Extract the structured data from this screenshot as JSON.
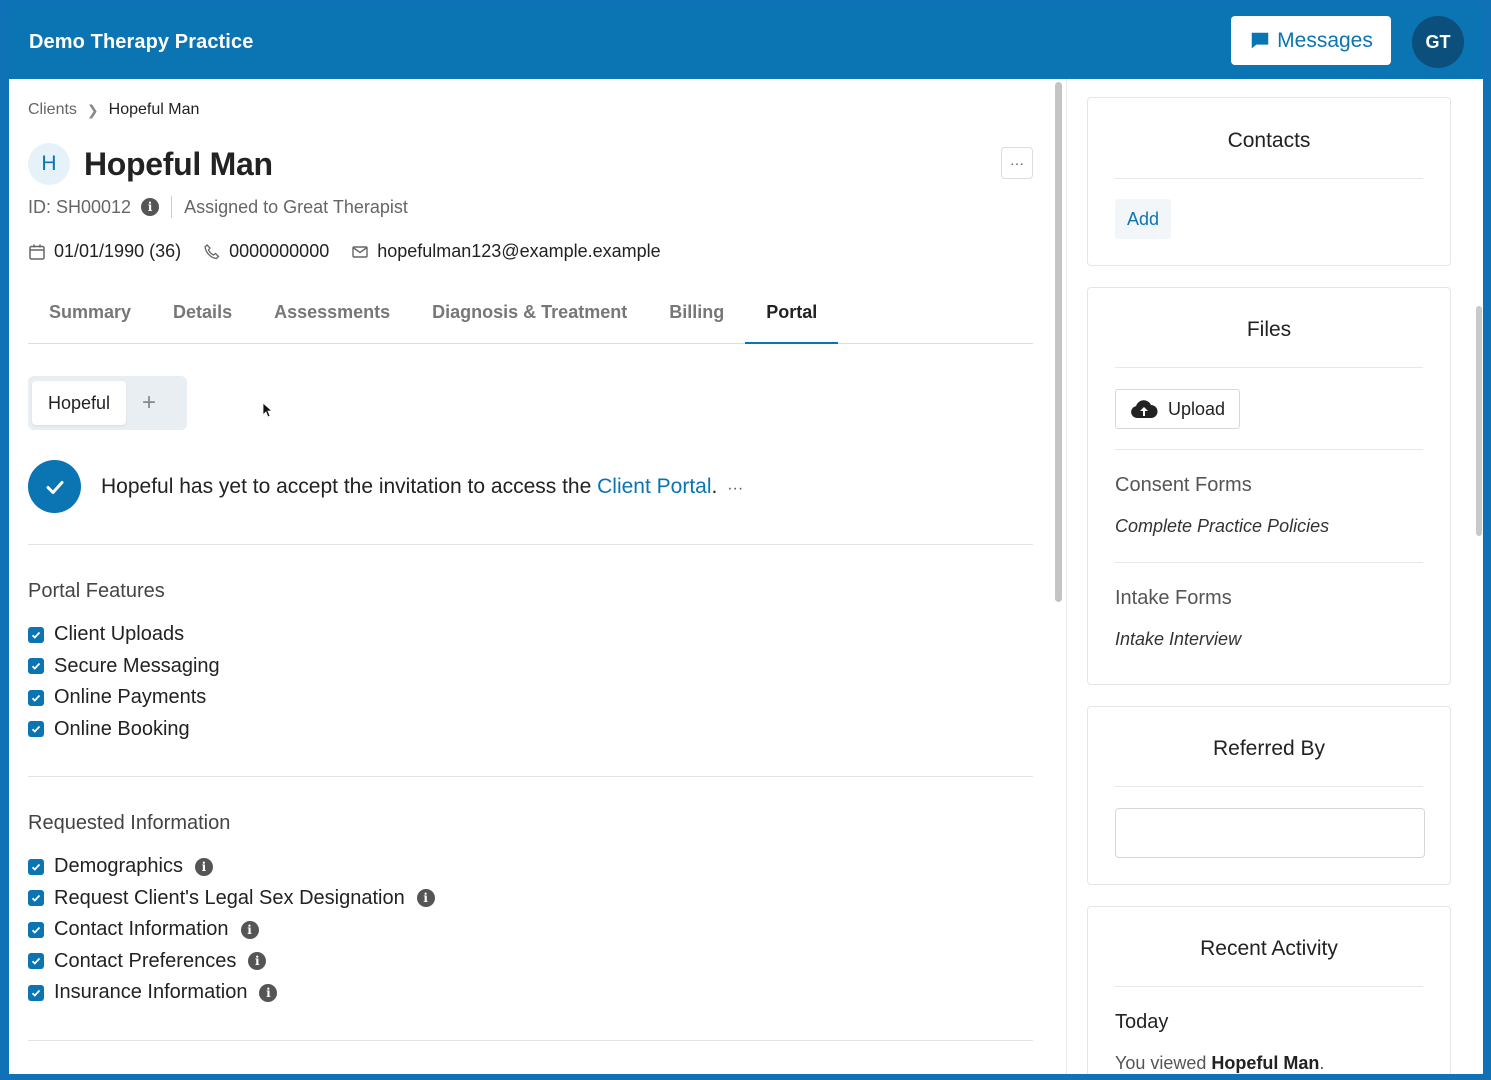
{
  "header": {
    "practice_name": "Demo Therapy Practice",
    "messages_label": "Messages",
    "user_initials": "GT"
  },
  "breadcrumb": {
    "parent": "Clients",
    "current": "Hopeful Man"
  },
  "client": {
    "initial": "H",
    "name": "Hopeful Man",
    "id_text": "ID: SH00012",
    "assigned": "Assigned to Great Therapist",
    "dob": "01/01/1990 (36)",
    "phone": "0000000000",
    "email": "hopefulman123@example.example",
    "more": "···"
  },
  "tabs": [
    "Summary",
    "Details",
    "Assessments",
    "Diagnosis & Treatment",
    "Billing",
    "Portal"
  ],
  "active_tab": "Portal",
  "portal": {
    "user_tab": "Hopeful",
    "add_symbol": "+",
    "invite_prefix": "Hopeful has yet to accept the invitation to access the ",
    "invite_link": "Client Portal",
    "invite_suffix": ".",
    "invite_more": "···",
    "features_title": "Portal Features",
    "features": [
      "Client Uploads",
      "Secure Messaging",
      "Online Payments",
      "Online Booking"
    ],
    "requested_title": "Requested Information",
    "requested": [
      "Demographics",
      "Request Client's Legal Sex Designation",
      "Contact Information",
      "Contact Preferences",
      "Insurance Information"
    ]
  },
  "sidebar": {
    "contacts_title": "Contacts",
    "contacts_add": "Add",
    "files_title": "Files",
    "upload_label": "Upload",
    "consent_title": "Consent Forms",
    "consent_item": "Complete Practice Policies",
    "intake_title": "Intake Forms",
    "intake_item": "Intake Interview",
    "referred_title": "Referred By",
    "referred_value": "",
    "activity_title": "Recent Activity",
    "activity_day": "Today",
    "activity_prefix": "You viewed ",
    "activity_subject": "Hopeful Man",
    "activity_suffix": "."
  },
  "colors": {
    "brand": "#0b74b2",
    "header_bg": "#0b74b2",
    "avatar_bg": "#0b4f7c"
  }
}
